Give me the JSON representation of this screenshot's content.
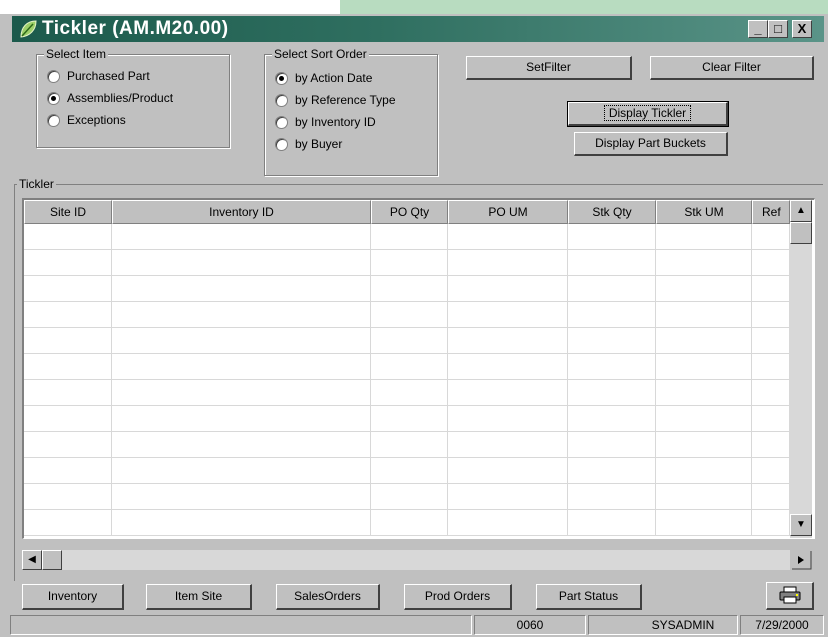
{
  "window": {
    "title": "Tickler  (AM.M20.00)",
    "controls": {
      "minimize": "_",
      "maximize": "□",
      "close": "X"
    }
  },
  "select_item": {
    "legend": "Select Item",
    "options": [
      {
        "label": "Purchased Part",
        "checked": false
      },
      {
        "label": "Assemblies/Product",
        "checked": true
      },
      {
        "label": "Exceptions",
        "checked": false
      }
    ]
  },
  "sort_order": {
    "legend": "Select Sort Order",
    "options": [
      {
        "label": "by Action Date",
        "checked": true
      },
      {
        "label": "by Reference Type",
        "checked": false
      },
      {
        "label": "by Inventory ID",
        "checked": false
      },
      {
        "label": "by Buyer",
        "checked": false
      }
    ]
  },
  "buttons": {
    "set_filter": "SetFilter",
    "clear_filter": "Clear Filter",
    "display_tickler": "Display Tickler",
    "display_part_buckets": "Display Part Buckets"
  },
  "tickler": {
    "legend": "Tickler",
    "columns": [
      "Site ID",
      "Inventory ID",
      "PO Qty",
      "PO UM",
      "Stk Qty",
      "Stk UM",
      "Ref"
    ]
  },
  "bottom_buttons": {
    "inventory": "Inventory",
    "item_site": "Item Site",
    "sales_orders": "SalesOrders",
    "prod_orders": "Prod Orders",
    "part_status": "Part Status"
  },
  "status_bar": {
    "panel1": "",
    "code": "0060",
    "user": "SYSADMIN",
    "date": "7/29/2000"
  },
  "colors": {
    "titlebar_start": "#1c5a4c",
    "titlebar_end": "#5a9488",
    "face": "#c0c0c0"
  }
}
